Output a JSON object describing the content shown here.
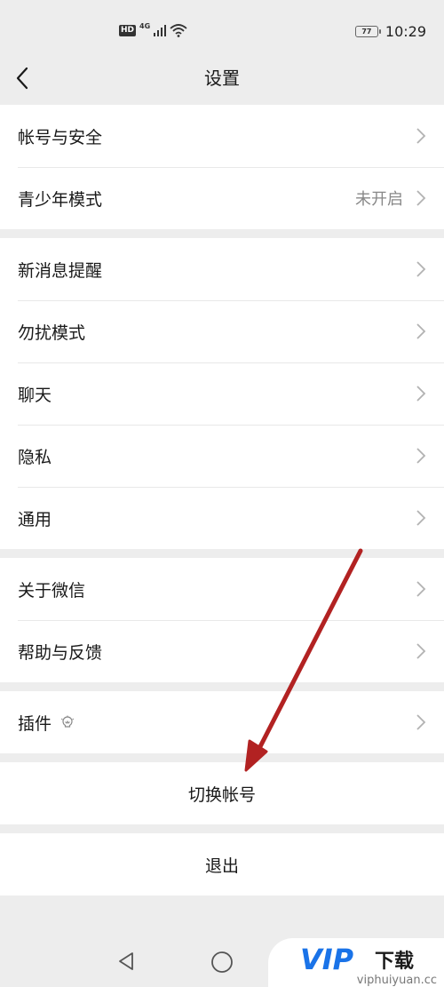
{
  "status_bar": {
    "hd_badge": "HD",
    "network": "4G",
    "battery_level": "77",
    "time": "10:29",
    "icons": [
      "hd-icon",
      "signal-icon",
      "wifi-icon",
      "battery-icon"
    ]
  },
  "header": {
    "title": "设置",
    "back_icon": "back-chevron-icon"
  },
  "groups": {
    "account": [
      {
        "label": "帐号与安全",
        "value": ""
      },
      {
        "label": "青少年模式",
        "value": "未开启"
      }
    ],
    "general": [
      {
        "label": "新消息提醒"
      },
      {
        "label": "勿扰模式"
      },
      {
        "label": "聊天"
      },
      {
        "label": "隐私"
      },
      {
        "label": "通用"
      }
    ],
    "about": [
      {
        "label": "关于微信"
      },
      {
        "label": "帮助与反馈"
      }
    ],
    "plugins": [
      {
        "label": "插件",
        "icon": "plugin-bulb-icon"
      }
    ]
  },
  "actions": {
    "switch_account": "切换帐号",
    "logout": "退出"
  },
  "system_nav": {
    "icons": [
      "back-triangle-icon",
      "home-circle-icon"
    ]
  },
  "watermark": {
    "logo_text": "VIP",
    "logo_suffix": "下载",
    "url": "viphuiyuan.cc",
    "brand_color": "#1a73e8"
  },
  "annotation": {
    "arrow_color": "#b22222",
    "points_to": "切换帐号"
  },
  "colors": {
    "background": "#ededed",
    "card": "#ffffff",
    "text": "#191919",
    "secondary_text": "#888888",
    "chevron": "#b2b2b2"
  }
}
